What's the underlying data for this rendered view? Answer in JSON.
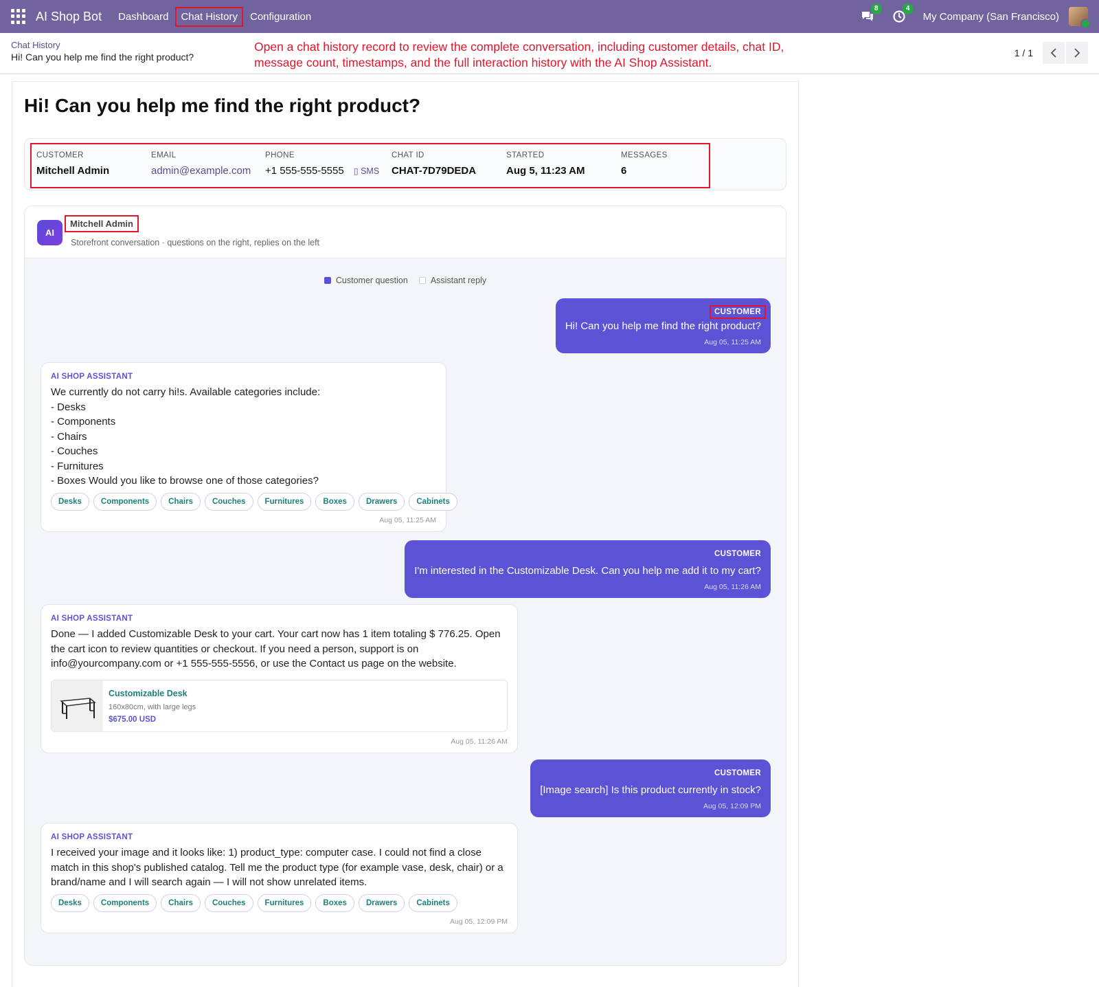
{
  "navbar": {
    "brand": "AI Shop Bot",
    "items": [
      "Dashboard",
      "Chat History",
      "Configuration"
    ],
    "messages_badge": "8",
    "activities_badge": "4",
    "company": "My Company (San Francisco)"
  },
  "breadcrumb": {
    "parent": "Chat History",
    "current": "Hi! Can you help me find the right product?"
  },
  "annotation": "Open a chat history record to review the complete conversation, including customer details, chat ID, message count, timestamps, and the full interaction history with the AI Shop Assistant.",
  "pager": {
    "value": "1 / 1"
  },
  "record": {
    "title": "Hi! Can you help me find the right product?",
    "info": {
      "customer_label": "CUSTOMER",
      "customer": "Mitchell Admin",
      "email_label": "EMAIL",
      "email": "admin@example.com",
      "phone_label": "PHONE",
      "phone": "+1 555-555-5555",
      "sms": "SMS",
      "chat_id_label": "CHAT ID",
      "chat_id": "CHAT-7D79DEDA",
      "started_label": "STARTED",
      "started": "Aug 5, 11:23 AM",
      "messages_label": "MESSAGES",
      "messages": "6"
    }
  },
  "conversation": {
    "avatar": "AI",
    "name": "Mitchell Admin",
    "subtitle": "Storefront conversation · questions on the right, replies on the left",
    "legend": {
      "customer": "Customer question",
      "assistant": "Assistant reply"
    },
    "customer_label": "CUSTOMER",
    "assistant_label": "AI SHOP ASSISTANT",
    "chips": [
      "Desks",
      "Components",
      "Chairs",
      "Couches",
      "Furnitures",
      "Boxes",
      "Drawers",
      "Cabinets"
    ],
    "messages": [
      {
        "text": "Hi! Can you help me find the right product?",
        "time": "Aug 05, 11:25 AM"
      },
      {
        "text": "We currently do not carry hi!s. Available categories include:\n- Desks\n- Components\n- Chairs\n- Couches\n- Furnitures\n- Boxes Would you like to browse one of those categories?",
        "time": "Aug 05, 11:25 AM"
      },
      {
        "text": "I'm interested in the Customizable Desk. Can you help me add it to my cart?",
        "time": "Aug 05, 11:26 AM"
      },
      {
        "text": "Done — I added Customizable Desk to your cart. Your cart now has 1 item totaling $ 776.25. Open the cart icon to review quantities or checkout. If you need a person, support is on info@yourcompany.com or +1 555-555-5556, or use the Contact us page on the website.",
        "time": "Aug 05, 11:26 AM",
        "product": {
          "name": "Customizable Desk",
          "desc": "160x80cm, with large legs",
          "price": "$675.00 USD"
        }
      },
      {
        "text": "[Image search] Is this product currently in stock?",
        "time": "Aug 05, 12:09 PM"
      },
      {
        "text": "I received your image and it looks like: 1) product_type: computer case. I could not find a close match in this shop's published catalog. Tell me the product type (for example vase, desk, chair) or a brand/name and I will search again — I will not show unrelated items.",
        "time": "Aug 05, 12:09 PM"
      }
    ]
  },
  "colors": {
    "navbar": "#71639e",
    "customer_bubble": "#5b52d6",
    "highlight": "#e0162b",
    "chip_text": "#1d7f7a"
  }
}
